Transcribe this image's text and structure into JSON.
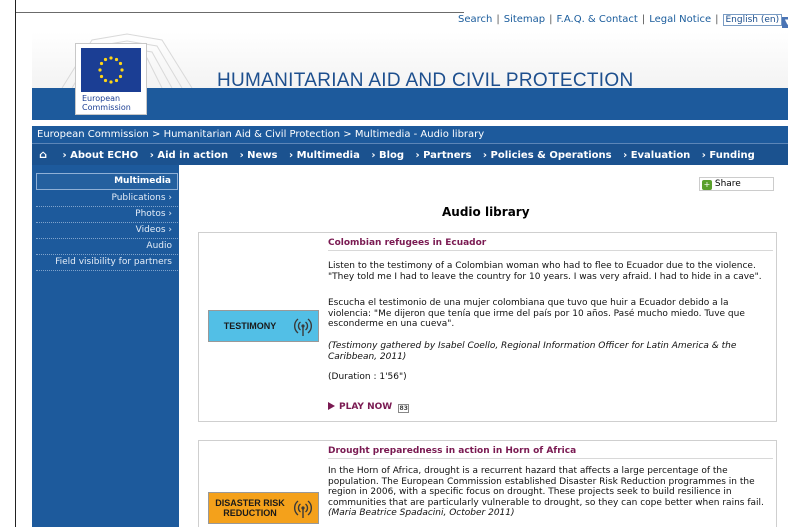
{
  "top_links": {
    "search": "Search",
    "sitemap": "Sitemap",
    "faq": "F.A.Q. & Contact",
    "legal": "Legal Notice",
    "language": "English (en)"
  },
  "header": {
    "logo_text_1": "European",
    "logo_text_2": "Commission",
    "site_title": "HUMANITARIAN AID AND CIVIL PROTECTION"
  },
  "breadcrumb": "European Commission > Humanitarian Aid & Civil Protection > Multimedia - Audio library",
  "nav": {
    "items": [
      "› About ECHO",
      "› Aid in action",
      "› News",
      "› Multimedia",
      "› Blog",
      "› Partners",
      "› Policies & Operations",
      "› Evaluation",
      "› Funding"
    ]
  },
  "sidebar": {
    "title": "Multimedia",
    "items": [
      "Publications ›",
      "Photos ›",
      "Videos ›",
      "Audio",
      "Field visibility for partners"
    ]
  },
  "share_label": "Share",
  "page_title": "Audio library",
  "cards": [
    {
      "title": "Colombian refugees in Ecuador",
      "badge": "TESTIMONY",
      "p1": "Listen to the testimony of a Colombian woman who had to flee to Ecuador due to the violence. \"They told me I had to leave the country for 10 years. I was very afraid. I had to hide in a cave\".",
      "p2": "Escucha el testimonio de una mujer colombiana que tuvo que huir a Ecuador debido a la violencia: \"Me dijeron que tenía que irme del país por 10 años. Pasé mucho miedo. Tuve que esconderme en una cueva\".",
      "p3": "(Testimony gathered by Isabel Coello, Regional Information Officer for Latin America & the Caribbean, 2011)",
      "p4": "(Duration : 1'56\")",
      "play": "PLAY NOW",
      "file": "83"
    },
    {
      "title": "Drought preparedness in action in Horn of Africa",
      "badge_line1": "DISASTER RISK",
      "badge_line2": "REDUCTION",
      "p1": "In the Horn of Africa, drought is a recurrent hazard that affects a large percentage of the population. The European Commission established Disaster Risk Reduction programmes in the region in 2006, with a specific focus on drought. These projects seek to build resilience in communities that are particularly vulnerable to drought, so they can cope better when rains fail.",
      "p1_credit": "(Maria Beatrice Spadacini, October 2011)"
    }
  ]
}
